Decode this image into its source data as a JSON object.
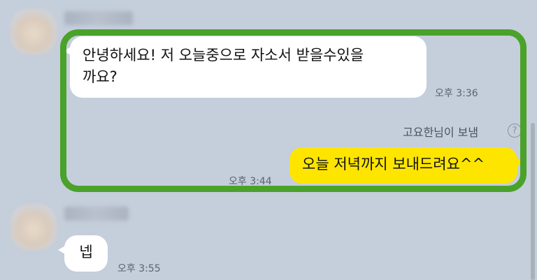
{
  "messages": [
    {
      "text_line1": "안녕하세요! 저 오늘중으로 자소서 받을수있을",
      "text_line2": "까요?",
      "time": "오후 3:36"
    },
    {
      "sent_by": "고요한님이 보냄",
      "help_icon_glyph": "?",
      "text": "오늘 저녁까지 보내드려요^^",
      "time": "오후 3:44"
    },
    {
      "text": "넵",
      "time": "오후 3:55"
    }
  ],
  "colors": {
    "background": "#c5cedb",
    "bubble_incoming": "#ffffff",
    "bubble_outgoing": "#fee500",
    "highlight": "#4aa22a"
  }
}
